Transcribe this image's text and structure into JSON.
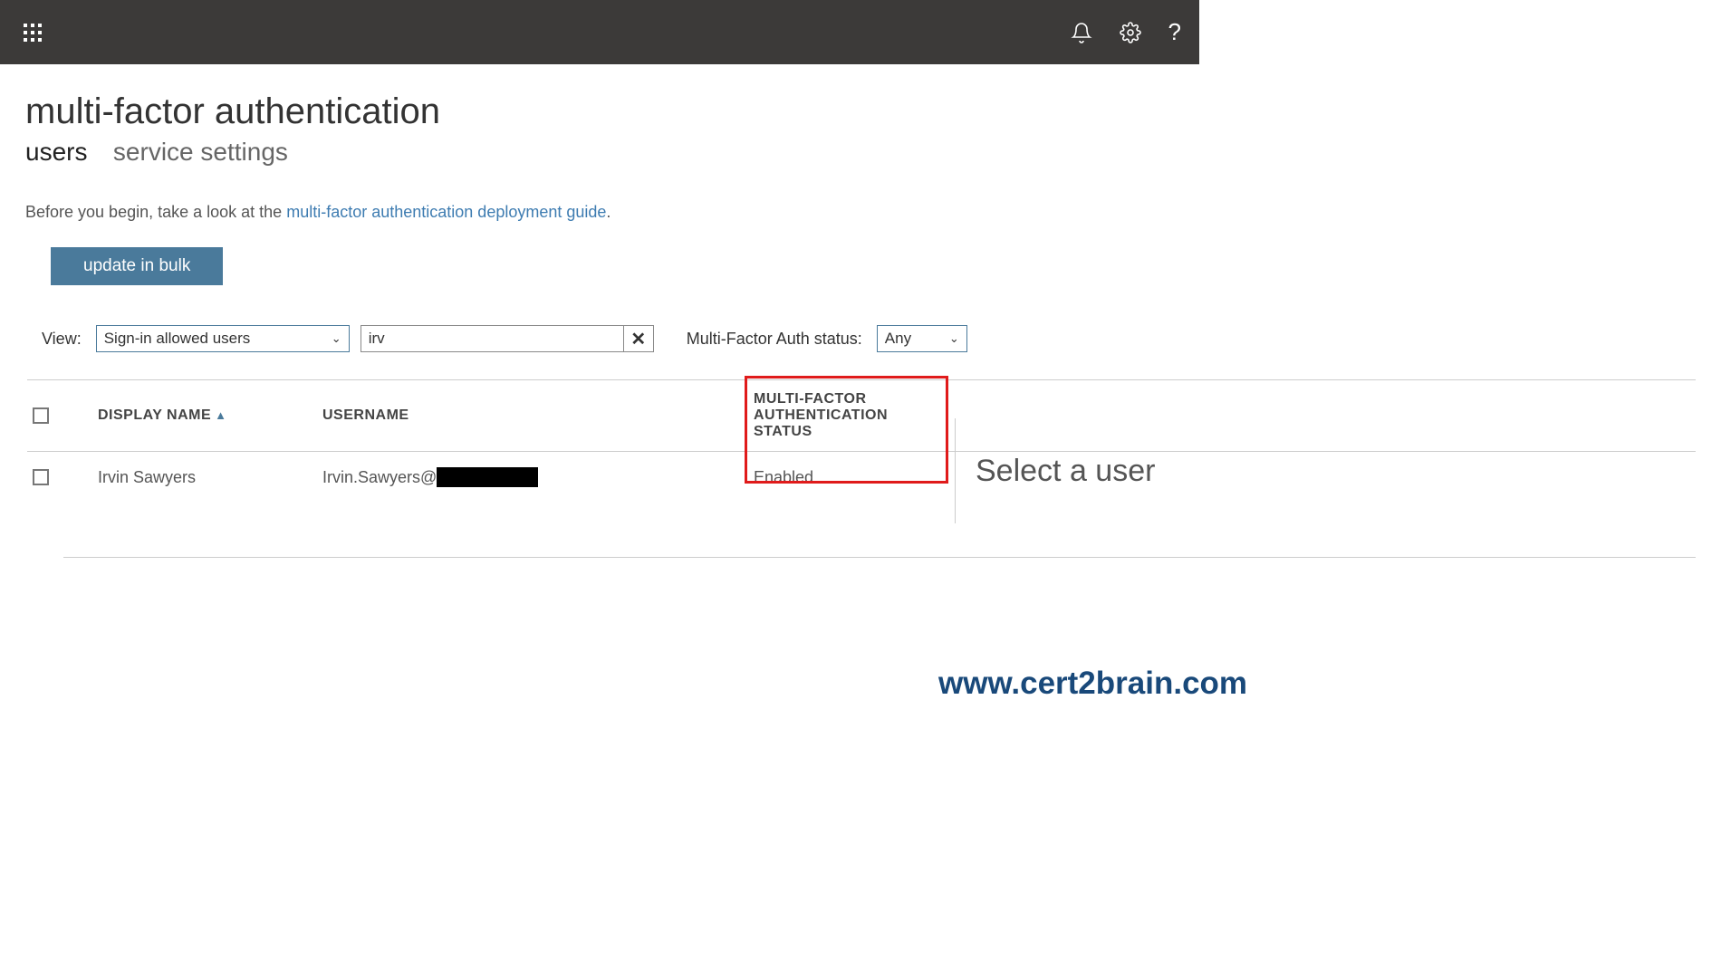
{
  "page": {
    "title": "multi-factor authentication"
  },
  "tabs": {
    "users": "users",
    "service_settings": "service settings"
  },
  "intro": {
    "prefix": "Before you begin, take a look at the ",
    "link": "multi-factor authentication deployment guide",
    "suffix": "."
  },
  "actions": {
    "update_bulk": "update in bulk"
  },
  "filters": {
    "view_label": "View:",
    "view_value": "Sign-in allowed users",
    "search_value": "irv",
    "status_label": "Multi-Factor Auth status:",
    "status_value": "Any"
  },
  "columns": {
    "display_name": "DISPLAY NAME",
    "username": "USERNAME",
    "mfa_status": "MULTI-FACTOR AUTHENTICATION STATUS"
  },
  "rows": [
    {
      "display_name": "Irvin Sawyers",
      "username_prefix": "Irvin.Sawyers@",
      "mfa_status": "Enabled"
    }
  ],
  "detail": {
    "placeholder": "Select a user"
  },
  "watermark": "www.cert2brain.com",
  "icons": {
    "waffle": "apps",
    "bell": "notifications",
    "gear": "settings",
    "help": "?",
    "clear": "✕"
  }
}
